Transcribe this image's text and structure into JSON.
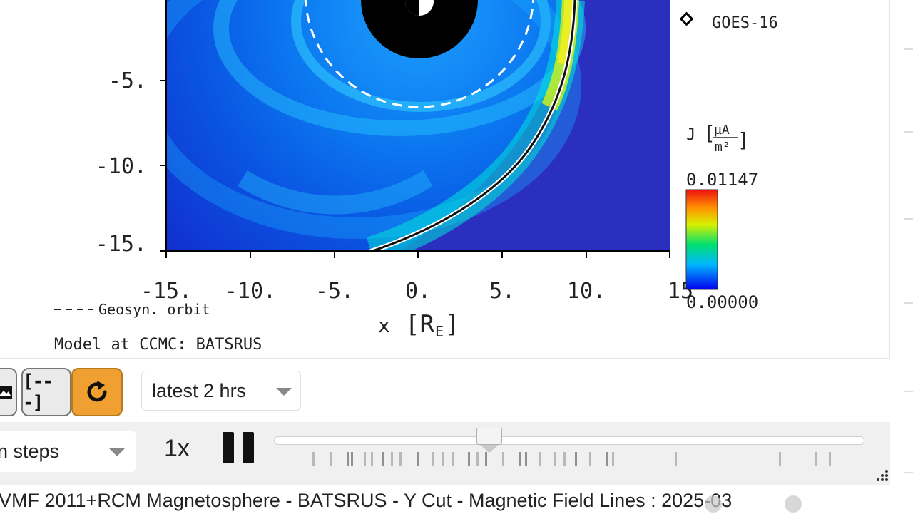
{
  "plot": {
    "y_ticks": [
      "-5.",
      "-10.",
      "-15."
    ],
    "x_ticks": [
      "-15.",
      "-10.",
      "-5.",
      "0.",
      "5.",
      "10.",
      "15"
    ],
    "x_axis_label": "x",
    "x_axis_unit": "[R",
    "x_axis_unit_sub": "E",
    "x_axis_unit_end": "]",
    "legend_orbit": "Geosyn. orbit",
    "model_label": "Model at CCMC: BATSRUS",
    "satellite_label": "GOES-16",
    "colorbar_var": "J",
    "colorbar_unit_num": "µA",
    "colorbar_unit_den": "m²",
    "colorbar_max": "0.01147",
    "colorbar_min": "0.00000"
  },
  "controls": {
    "bracket_button": "[---]",
    "time_range": "latest 2 hrs",
    "step_mode": "n steps",
    "speed": "1x"
  },
  "slider": {
    "position_fraction": 0.36
  },
  "status": {
    "title": "VMF 2011+RCM Magnetosphere - BATSRUS - Y Cut - Magnetic Field Lines : 2025-03"
  },
  "colors": {
    "refresh_button": "#f0a030",
    "field_background": "#2a2fc0",
    "field_line": "#111111"
  },
  "icons": {
    "image": "image-icon",
    "refresh": "refresh-icon",
    "caret": "chevron-down-icon",
    "pause": "pause-icon"
  }
}
